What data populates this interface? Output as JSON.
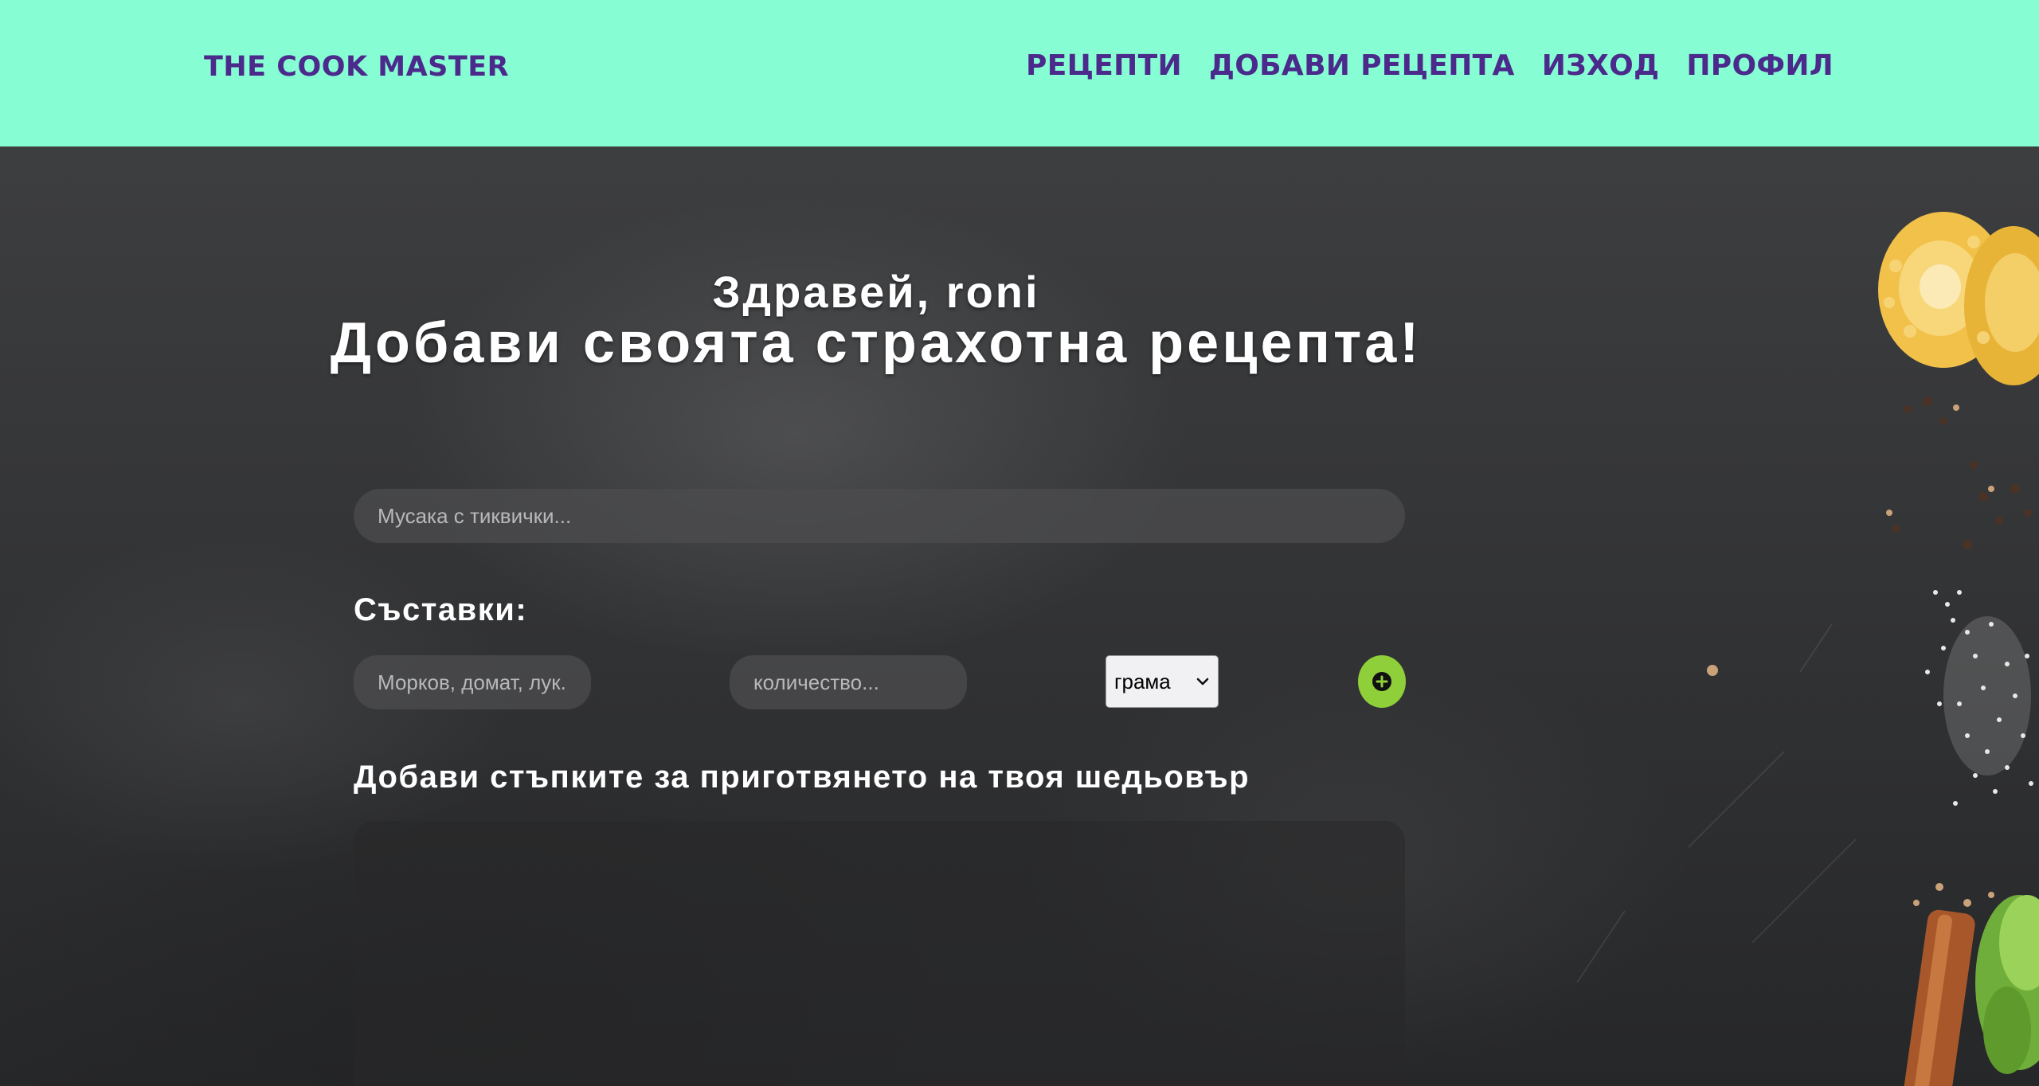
{
  "header": {
    "brand": "THE COOK MASTER",
    "nav": [
      {
        "label": "РЕЦЕПТИ"
      },
      {
        "label": "ДОБАВИ РЕЦЕПТА"
      },
      {
        "label": "ИЗХОД"
      },
      {
        "label": "ПРОФИЛ"
      }
    ]
  },
  "hero": {
    "greeting": "Здравей, roni",
    "title": "Добави своята страхотна рецепта!"
  },
  "form": {
    "recipe_name": {
      "value": "",
      "placeholder": "Мусака с тиквички..."
    },
    "ingredients_label": "Съставки:",
    "ingredient": {
      "value": "",
      "placeholder": "Морков, домат, лук..."
    },
    "quantity": {
      "value": "",
      "placeholder": "количество..."
    },
    "unit": {
      "selected": "грама"
    },
    "add_ingredient_icon": "plus-circle-icon",
    "steps_label": "Добави стъпките за приготвянето на твоя шедьовър",
    "steps": {
      "value": "",
      "placeholder": ""
    }
  },
  "colors": {
    "header_bg": "#86fdd3",
    "nav_text": "#4b2a8c",
    "add_button": "#8fd03a",
    "page_bg": "#333436"
  }
}
